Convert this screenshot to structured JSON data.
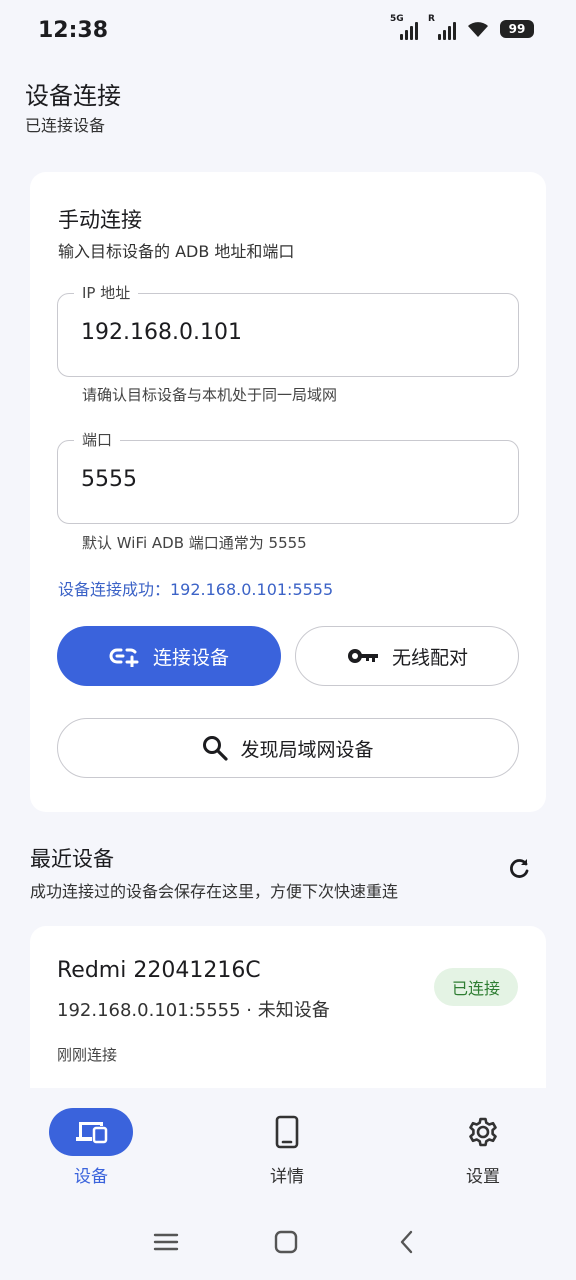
{
  "status": {
    "time": "12:38",
    "network1_tag": "5G",
    "network2_tag": "R",
    "battery": "99"
  },
  "header": {
    "title": "设备连接",
    "subtitle": "已连接设备"
  },
  "manual": {
    "title": "手动连接",
    "subtitle": "输入目标设备的 ADB 地址和端口",
    "ip_label": "IP 地址",
    "ip_value": "192.168.0.101",
    "ip_helper": "请确认目标设备与本机处于同一局域网",
    "port_label": "端口",
    "port_value": "5555",
    "port_helper": "默认 WiFi ADB 端口通常为 5555",
    "success_message": "设备连接成功：192.168.0.101:5555",
    "connect_button": "连接设备",
    "pair_button": "无线配对",
    "discover_button": "发现局域网设备"
  },
  "recent": {
    "title": "最近设备",
    "subtitle": "成功连接过的设备会保存在这里，方便下次快速重连",
    "devices": [
      {
        "name": "Redmi 22041216C",
        "address": "192.168.0.101:5555 · 未知设备",
        "time": "刚刚连接",
        "status": "已连接"
      }
    ]
  },
  "nav": {
    "items": [
      {
        "label": "设备",
        "icon": "devices-icon",
        "active": true
      },
      {
        "label": "详情",
        "icon": "phone-icon",
        "active": false
      },
      {
        "label": "设置",
        "icon": "gear-icon",
        "active": false
      }
    ]
  },
  "colors": {
    "accent": "#3a63dc",
    "success_text": "#2e7d32",
    "success_bg": "#e4f3e4",
    "background": "#f5f6fb"
  }
}
